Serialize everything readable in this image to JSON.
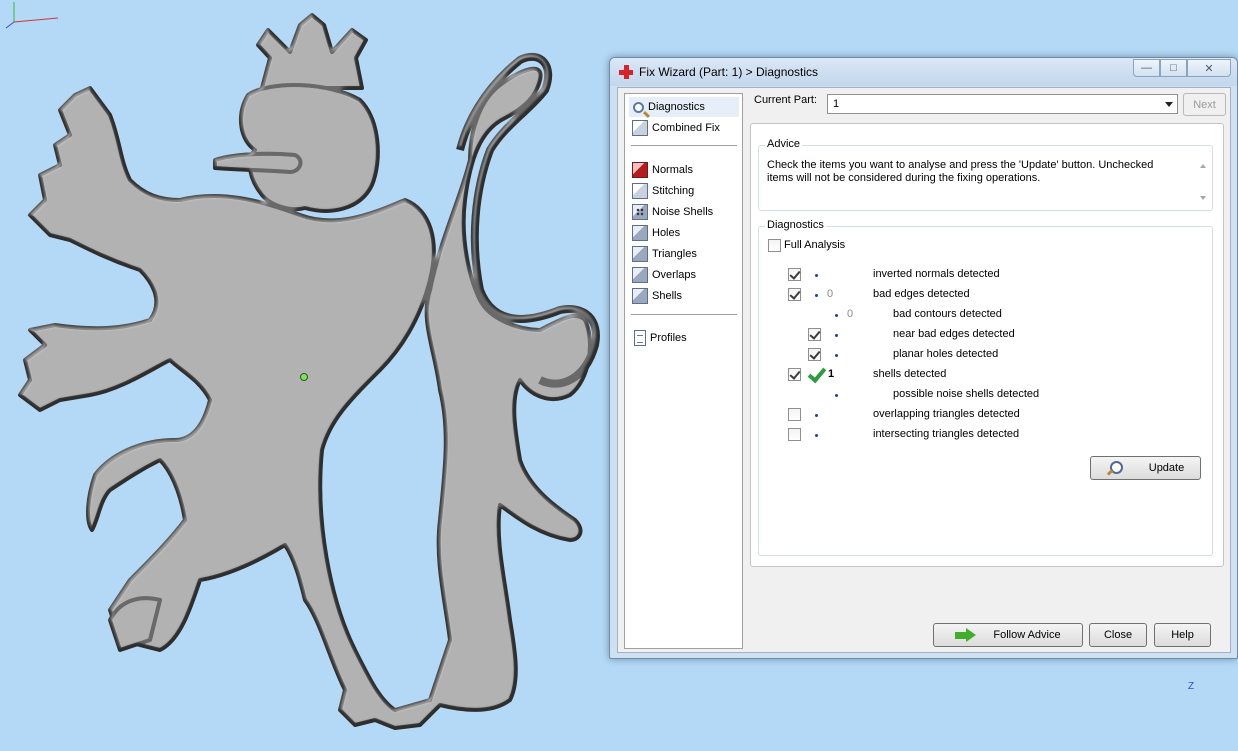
{
  "window": {
    "title": "Fix Wizard (Part: 1) > Diagnostics",
    "minimize_glyph": "—",
    "maximize_glyph": "□",
    "close_glyph": "✕"
  },
  "nav": {
    "items": [
      {
        "label": "Diagnostics",
        "icon": "magnifier-icon"
      },
      {
        "label": "Combined Fix",
        "icon": "cube-icon"
      },
      {
        "label": "Normals",
        "icon": "red-cube-icon"
      },
      {
        "label": "Stitching",
        "icon": "cube-icon"
      },
      {
        "label": "Noise Shells",
        "icon": "dotted-cube-icon"
      },
      {
        "label": "Holes",
        "icon": "cube-icon"
      },
      {
        "label": "Triangles",
        "icon": "cube-icon"
      },
      {
        "label": "Overlaps",
        "icon": "cube-icon"
      },
      {
        "label": "Shells",
        "icon": "cube-icon"
      },
      {
        "label": "Profiles",
        "icon": "document-icon"
      }
    ]
  },
  "current_part": {
    "label": "Current Part:",
    "value": "1",
    "next_label": "Next"
  },
  "advice": {
    "title": "Advice",
    "text": "Check the items you want to analyse and press the 'Update' button. Unchecked items will not be considered during the fixing operations."
  },
  "diagnostics": {
    "title": "Diagnostics",
    "full_analysis_label": "Full Analysis",
    "rows": [
      {
        "checkbox": true,
        "checked": true,
        "count": "",
        "label": "inverted normals detected"
      },
      {
        "checkbox": true,
        "checked": true,
        "count": "0",
        "label": "bad edges detected"
      },
      {
        "checkbox": false,
        "checked": false,
        "count": "0",
        "label": "bad contours detected"
      },
      {
        "checkbox": true,
        "checked": true,
        "count": "",
        "label": "near bad edges detected"
      },
      {
        "checkbox": true,
        "checked": true,
        "count": "",
        "label": "planar holes detected"
      },
      {
        "checkbox": true,
        "checked": true,
        "count": "1",
        "label": "shells detected"
      },
      {
        "checkbox": false,
        "checked": false,
        "count": "",
        "label": "possible noise shells detected"
      },
      {
        "checkbox": true,
        "checked": false,
        "count": "",
        "label": "overlapping triangles detected"
      },
      {
        "checkbox": true,
        "checked": false,
        "count": "",
        "label": "intersecting triangles detected"
      }
    ],
    "update_label": "Update"
  },
  "footer": {
    "follow_advice_label": "Follow Advice",
    "close_label": "Close",
    "help_label": "Help"
  },
  "axis": {
    "z_label": "Z"
  },
  "colors": {
    "viewport_bg": "#b3d9f7",
    "model_fill": "#9a9a9a",
    "ok_check": "#2c9c3c",
    "title_icon": "#d9222a"
  }
}
